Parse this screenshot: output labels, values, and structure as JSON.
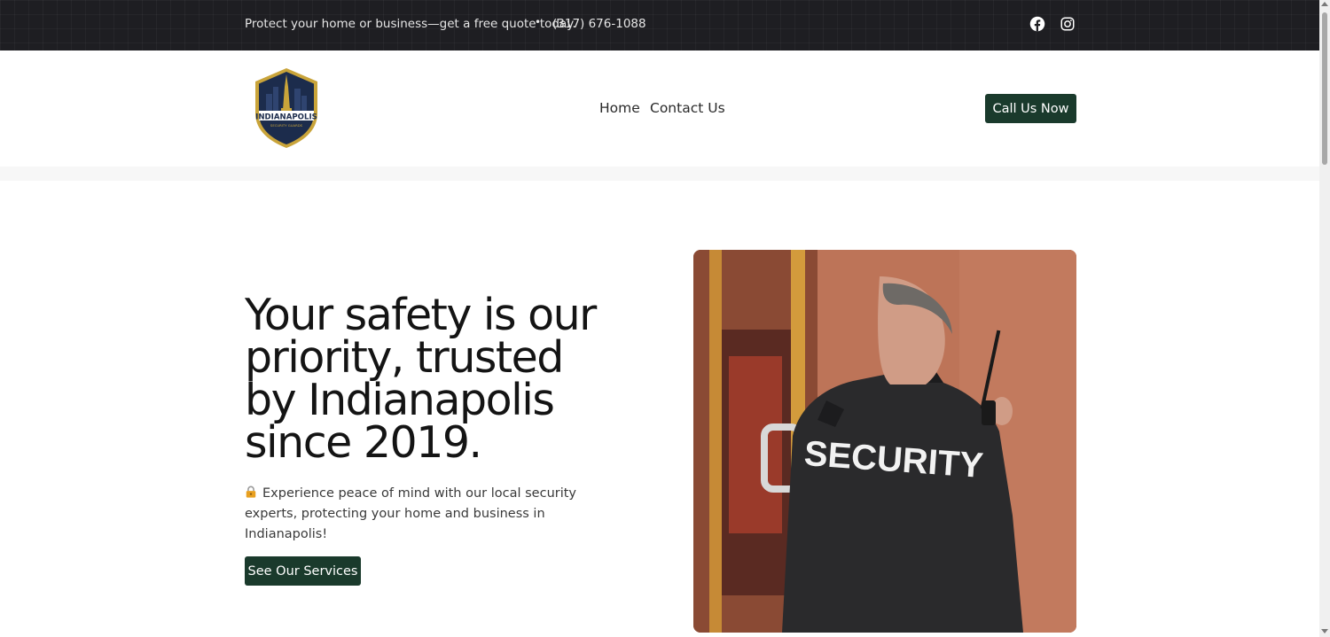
{
  "topbar": {
    "promo": "Protect your home or business—get a free quote today.",
    "separator": "•",
    "phone": "(317) 676-1088",
    "social_icons": [
      "facebook-icon",
      "instagram-icon"
    ]
  },
  "header": {
    "logo": {
      "name": "INDIANAPOLIS",
      "tagline": "SECURITY GUARDS"
    },
    "nav": {
      "home": "Home",
      "contact": "Contact Us"
    },
    "cta": "Call Us Now"
  },
  "hero": {
    "title": "Your safety is our priority, trusted by Indianapolis since 2019.",
    "lock_icon": "lock-icon",
    "text": "Experience peace of mind with our local security experts, protecting your home and business in Indianapolis!",
    "button": "See Our Services",
    "photo_text": "SECURITY"
  },
  "colors": {
    "topbar_bg": "#1e1e22",
    "button_bg": "#1a3a2c",
    "logo_navy": "#1c2c4c",
    "logo_gold": "#c9a43a"
  }
}
